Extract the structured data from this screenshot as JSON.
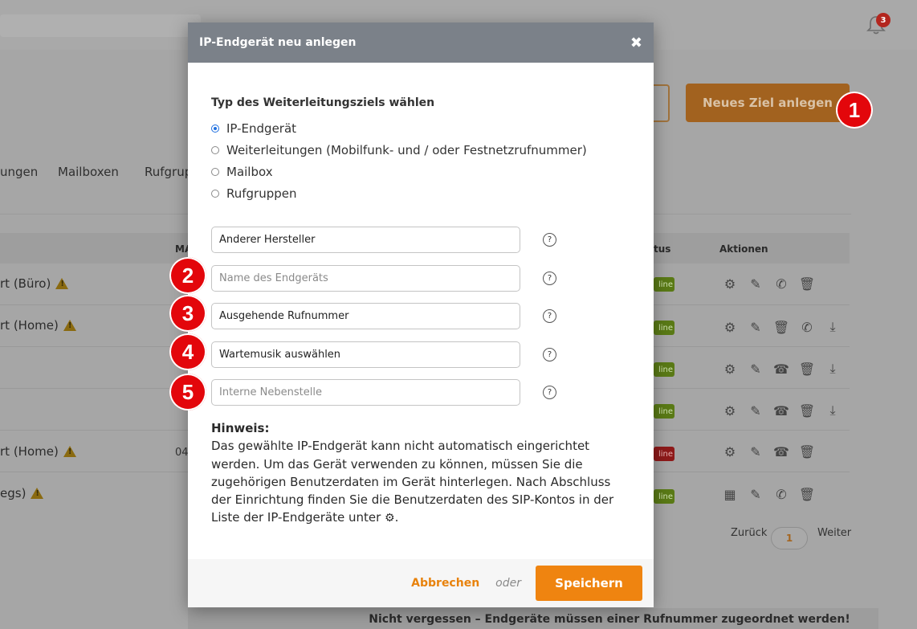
{
  "colors": {
    "accent": "#ef8410",
    "header_bg": "#7b8189",
    "callout_red": "#e3060b",
    "radio_blue": "#1f6fe0",
    "status_online": "#5a7a16",
    "status_offline": "#8e1a1a"
  },
  "topbar": {
    "notification_count": "3",
    "bell_icon": "bell-icon"
  },
  "background": {
    "primary_button_label": "Neues Ziel anlegen",
    "tabs": [
      "ungen",
      "Mailboxen",
      "Rufgrup"
    ],
    "table_headers": {
      "ma": "MA",
      "status": "tus",
      "actions": "Aktionen"
    },
    "rows": [
      {
        "name": "rt (Büro)",
        "warning": true,
        "status": "line"
      },
      {
        "name": "rt (Home)",
        "warning": true,
        "status": "line"
      },
      {
        "name": "",
        "warning": false,
        "status": "line"
      },
      {
        "name": "",
        "warning": false,
        "status": "line"
      },
      {
        "name": "rt (Home)",
        "warning": true,
        "status": "line",
        "ma_value": "04"
      },
      {
        "name": "egs)",
        "warning": true,
        "status": "line"
      }
    ],
    "pagination": {
      "prev": "Zurück",
      "page": "1",
      "next": "Weiter"
    },
    "bottom_note": "Nicht vergessen – Endgeräte müssen einer Rufnummer zugeordnet werden!"
  },
  "modal": {
    "title": "IP-Endgerät neu anlegen",
    "close_glyph": "✖",
    "type_section_title": "Typ des Weiterleitungsziels wählen",
    "radio_options": [
      {
        "label": "IP-Endgerät",
        "checked": true
      },
      {
        "label": "Weiterleitungen (Mobilfunk- und / oder Festnetzrufnummer)",
        "checked": false
      },
      {
        "label": "Mailbox",
        "checked": false
      },
      {
        "label": "Rufgruppen",
        "checked": false
      }
    ],
    "fields": {
      "manufacturer": {
        "value": "Anderer Hersteller"
      },
      "device_name": {
        "placeholder": "Name des Endgeräts"
      },
      "outgoing_number": {
        "value": "Ausgehende Rufnummer"
      },
      "hold_music": {
        "value": "Wartemusik auswählen"
      },
      "extension": {
        "placeholder": "Interne Nebenstelle"
      }
    },
    "help_glyph": "?",
    "note": {
      "title": "Hinweis:",
      "text": "Das gewählte IP-Endgerät kann nicht automatisch eingerichtet werden. Um das Gerät verwenden zu können, müssen Sie die zugehörigen Benutzerdaten im Gerät hinterlegen. Nach Abschluss der Einrichtung finden Sie die Benutzerdaten des SIP-Kontos in der Liste der IP-Endgeräte unter",
      "trailing": "."
    },
    "footer": {
      "cancel": "Abbrechen",
      "or": "oder",
      "save": "Speichern"
    }
  },
  "callouts": [
    "1",
    "2",
    "3",
    "4",
    "5"
  ]
}
